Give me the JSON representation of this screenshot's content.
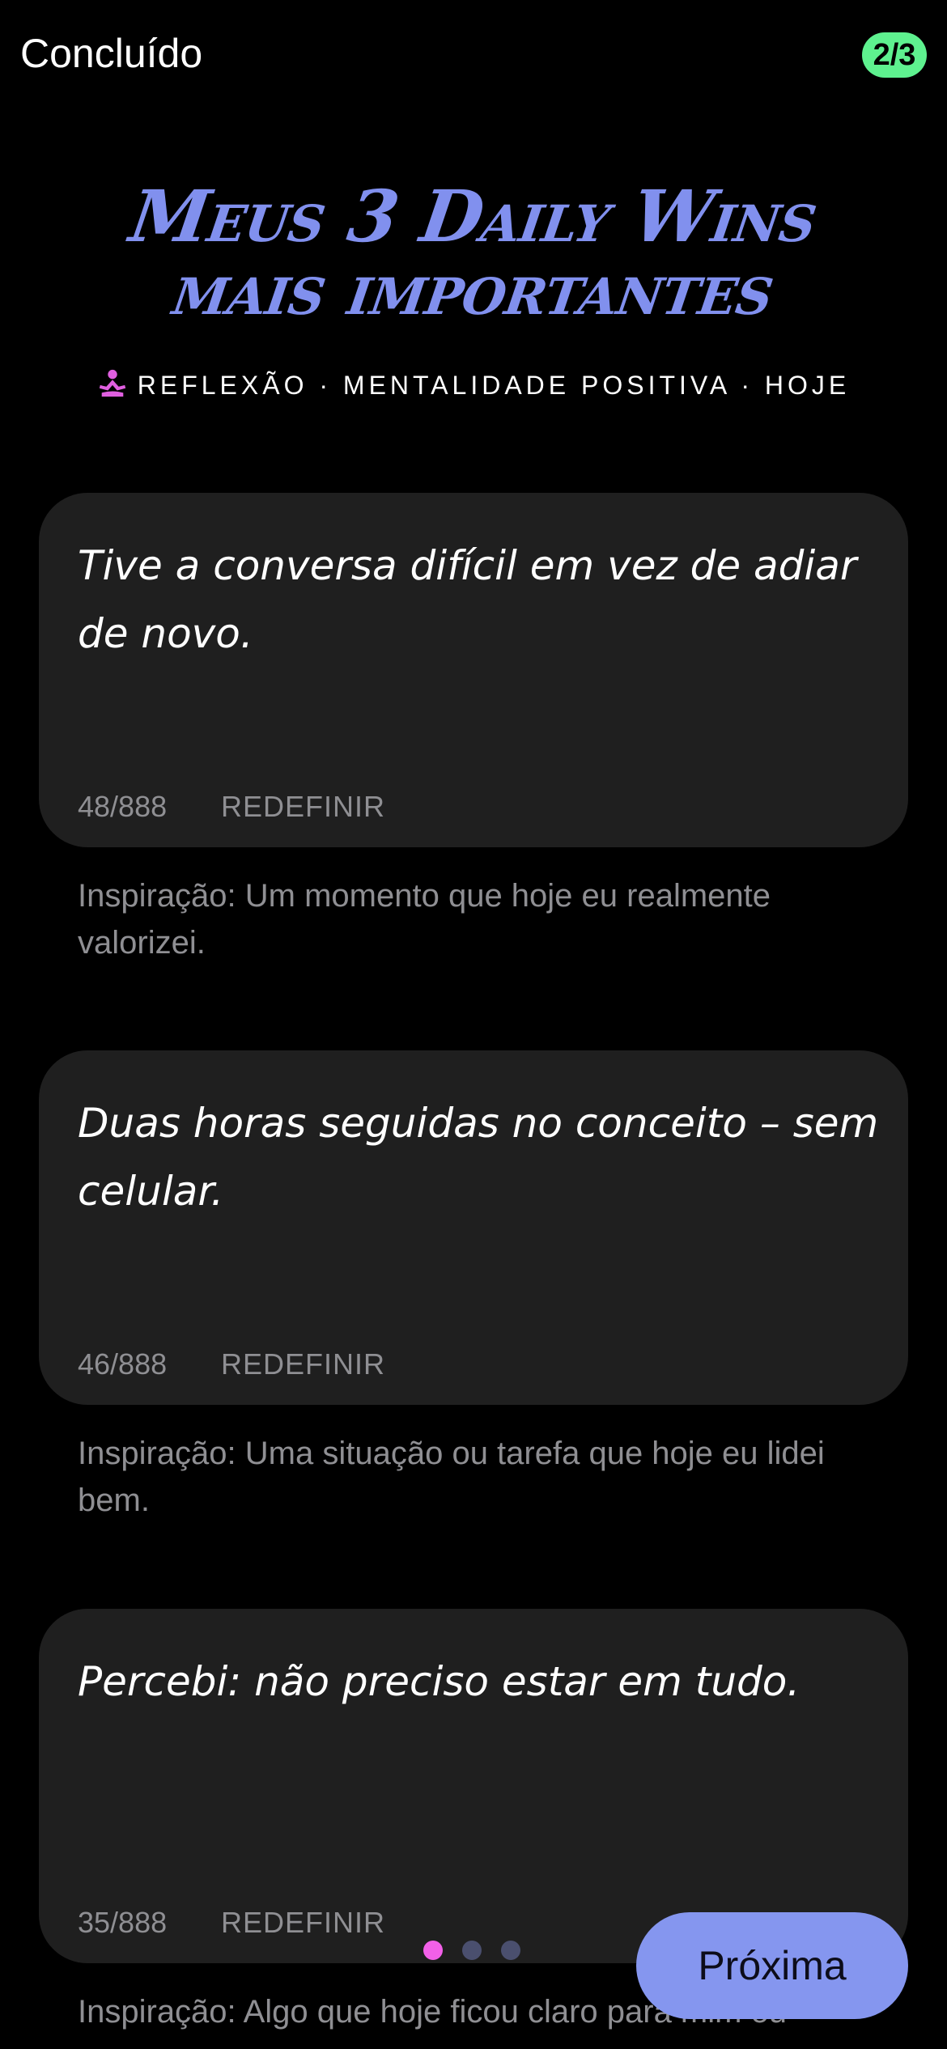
{
  "header": {
    "done_label": "Concluído",
    "progress": "2/3"
  },
  "title": {
    "line1": "Meus 3 Daily Wins",
    "line2": "mais importantes"
  },
  "subtitle": {
    "icon": "meditation-icon",
    "text": "REFLEXÃO · MENTALIDADE POSITIVA · HOJE"
  },
  "cards": [
    {
      "text": "Tive a conversa difícil em vez de adiar de novo.",
      "count": "48/888",
      "reset_label": "REDEFINIR",
      "hint": "Inspiração: Um momento que hoje eu realmente valorizei."
    },
    {
      "text": "Duas horas seguidas no conceito – sem celular.",
      "count": "46/888",
      "reset_label": "REDEFINIR",
      "hint": "Inspiração: Uma situação ou tarefa que hoje eu lidei bem."
    },
    {
      "text": "Percebi: não preciso estar em tudo.",
      "count": "35/888",
      "reset_label": "REDEFINIR",
      "hint": "Inspiração: Algo que hoje ficou claro para mim ou"
    }
  ],
  "pager": {
    "active_index": 0,
    "count": 3,
    "active_color": "#f260e8",
    "inactive_color": "#4a4f6e"
  },
  "next_button": {
    "label": "Próxima"
  },
  "colors": {
    "accent": "#8190ee",
    "badge": "#5ef18f",
    "card_bg": "#1f1f1f",
    "muted_text": "#8f8f93",
    "icon_pink": "#e05fe0"
  }
}
